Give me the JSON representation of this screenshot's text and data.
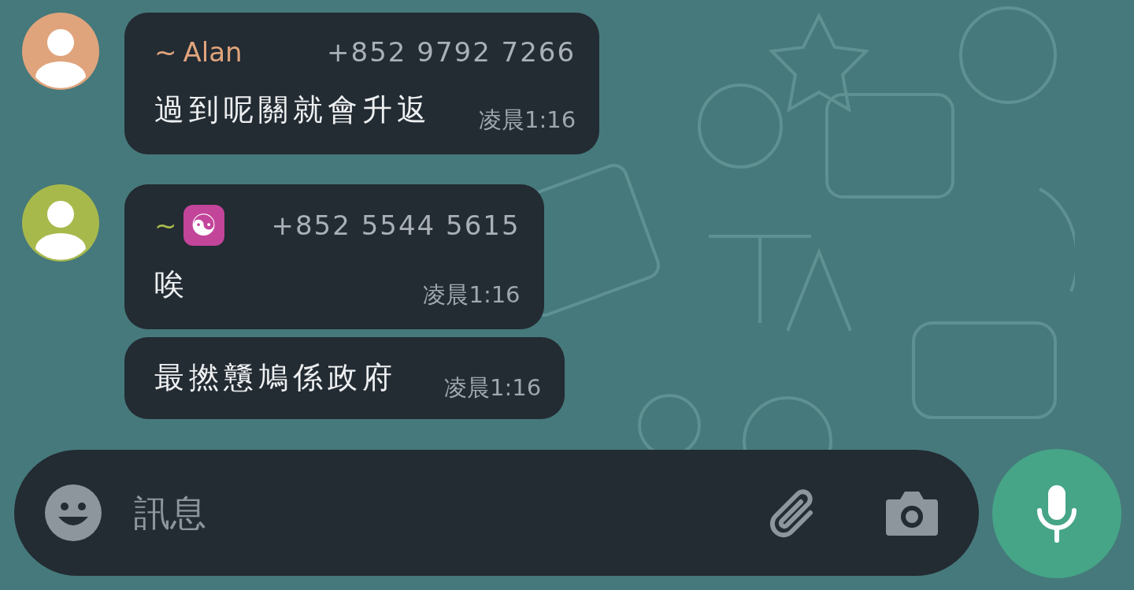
{
  "messages": [
    {
      "sender": {
        "tilde": "~",
        "name": "Alan",
        "kind": "text"
      },
      "color": "#e0a47c",
      "phone": "+852 9792 7266",
      "text": "過到呢關就會升返",
      "time": "凌晨1:16"
    },
    {
      "sender": {
        "tilde": "~",
        "name": "☯",
        "kind": "emoji"
      },
      "color": "#a8b94c",
      "phone": "+852 5544 5615",
      "text": "唉",
      "time": "凌晨1:16"
    },
    {
      "text": "最撚戇鳩係政府",
      "time": "凌晨1:16"
    }
  ],
  "composer": {
    "placeholder": "訊息"
  }
}
